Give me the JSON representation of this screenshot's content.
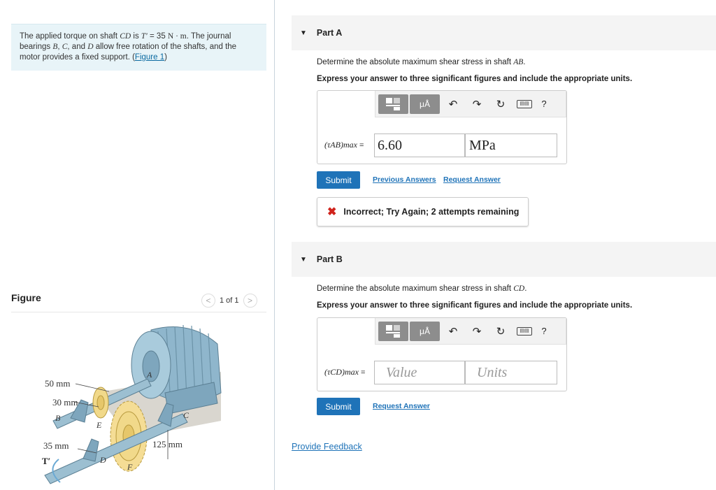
{
  "problem": {
    "text_1": "The applied torque on shaft ",
    "sym_CD": "CD",
    "text_2": " is ",
    "sym_T": "T′",
    "text_3": " = 35 ",
    "sym_unit": "N · m",
    "text_4": ". The journal bearings ",
    "sym_B": "B",
    "text_5": ", ",
    "sym_C": "C",
    "text_6": ", and ",
    "sym_D": "D",
    "text_7": " allow free rotation of the shafts, and the motor provides a fixed support. (",
    "figure_link": "Figure 1",
    "text_8": ")"
  },
  "figure": {
    "title": "Figure",
    "pager": "1 of 1",
    "prev": "<",
    "next": ">",
    "labels": {
      "d50": "50 mm",
      "d30": "30 mm",
      "d35": "35 mm",
      "d125": "125 mm",
      "A": "A",
      "B": "B",
      "C": "C",
      "D": "D",
      "E": "E",
      "F": "F",
      "T": "T′"
    }
  },
  "partA": {
    "header": "Part A",
    "question_prefix": "Determine the absolute maximum shear stress in shaft ",
    "question_sym": "AB",
    "question_suffix": ".",
    "instruction": "Express your answer to three significant figures and include the appropriate units.",
    "label_sym": "(τAB)max",
    "label_eq": " =",
    "value": "6.60",
    "units": "MPa",
    "submit": "Submit",
    "previous_answers": "Previous Answers",
    "request_answer": "Request Answer",
    "feedback": "Incorrect; Try Again; 2 attempts remaining"
  },
  "partB": {
    "header": "Part B",
    "question_prefix": "Determine the absolute maximum shear stress in shaft ",
    "question_sym": "CD",
    "question_suffix": ".",
    "instruction": "Express your answer to three significant figures and include the appropriate units.",
    "label_sym": "(τCD)max",
    "label_eq": " =",
    "value_placeholder": "Value",
    "units_placeholder": "Units",
    "submit": "Submit",
    "request_answer": "Request Answer"
  },
  "toolbar": {
    "mu_label": "μÅ",
    "help": "?",
    "icons": [
      "templates-icon",
      "symbols-icon",
      "undo-icon",
      "redo-icon",
      "reset-icon",
      "keyboard-icon",
      "help-icon"
    ]
  },
  "provide_feedback": "Provide Feedback",
  "colors": {
    "accent": "#1f73b8",
    "problem_bg": "#e8f4f8",
    "error": "#d0231c",
    "part_header_bg": "#f4f4f4"
  }
}
